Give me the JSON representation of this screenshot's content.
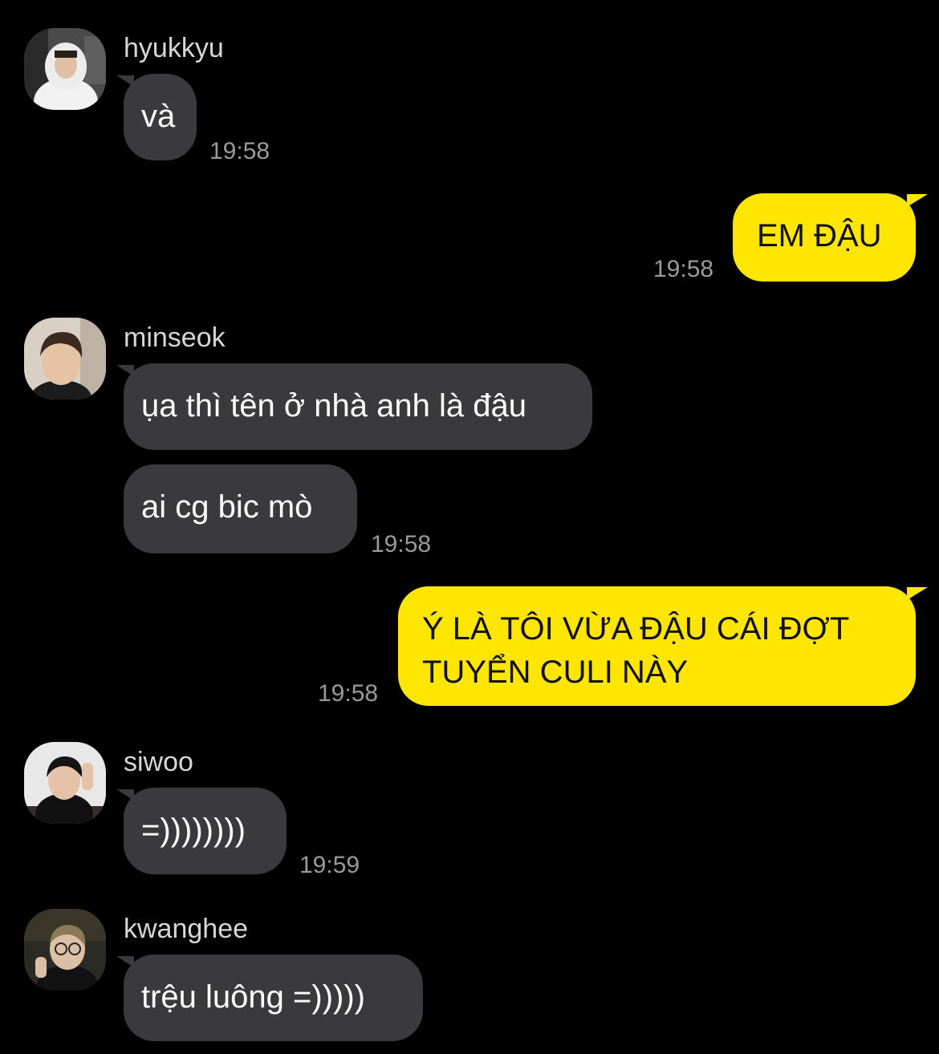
{
  "messages": [
    {
      "sender": "hyukkyu",
      "avatar": "hyukkyu-avatar",
      "texts": [
        "và"
      ],
      "time": "19:58"
    },
    {
      "outgoing": true,
      "text": "EM ĐẬU",
      "time": "19:58"
    },
    {
      "sender": "minseok",
      "avatar": "minseok-avatar",
      "texts": [
        "ụa thì tên ở nhà anh là đậu",
        "ai cg bic mò"
      ],
      "time": "19:58"
    },
    {
      "outgoing": true,
      "text_lines": [
        "Ý LÀ TÔI VỪA ĐẬU CÁI ĐỢT",
        "TUYỂN CULI NÀY"
      ],
      "time": "19:58"
    },
    {
      "sender": "siwoo",
      "avatar": "siwoo-avatar",
      "texts": [
        "=))))))))"
      ],
      "time": "19:59"
    },
    {
      "sender": "kwanghee",
      "avatar": "kwanghee-avatar",
      "texts": [
        "trệu luông =)))))"
      ]
    }
  ],
  "colors": {
    "background": "#000000",
    "incoming_bubble": "#3a3a3c",
    "outgoing_bubble": "#ffe600",
    "timestamp": "#9a9a9a"
  }
}
